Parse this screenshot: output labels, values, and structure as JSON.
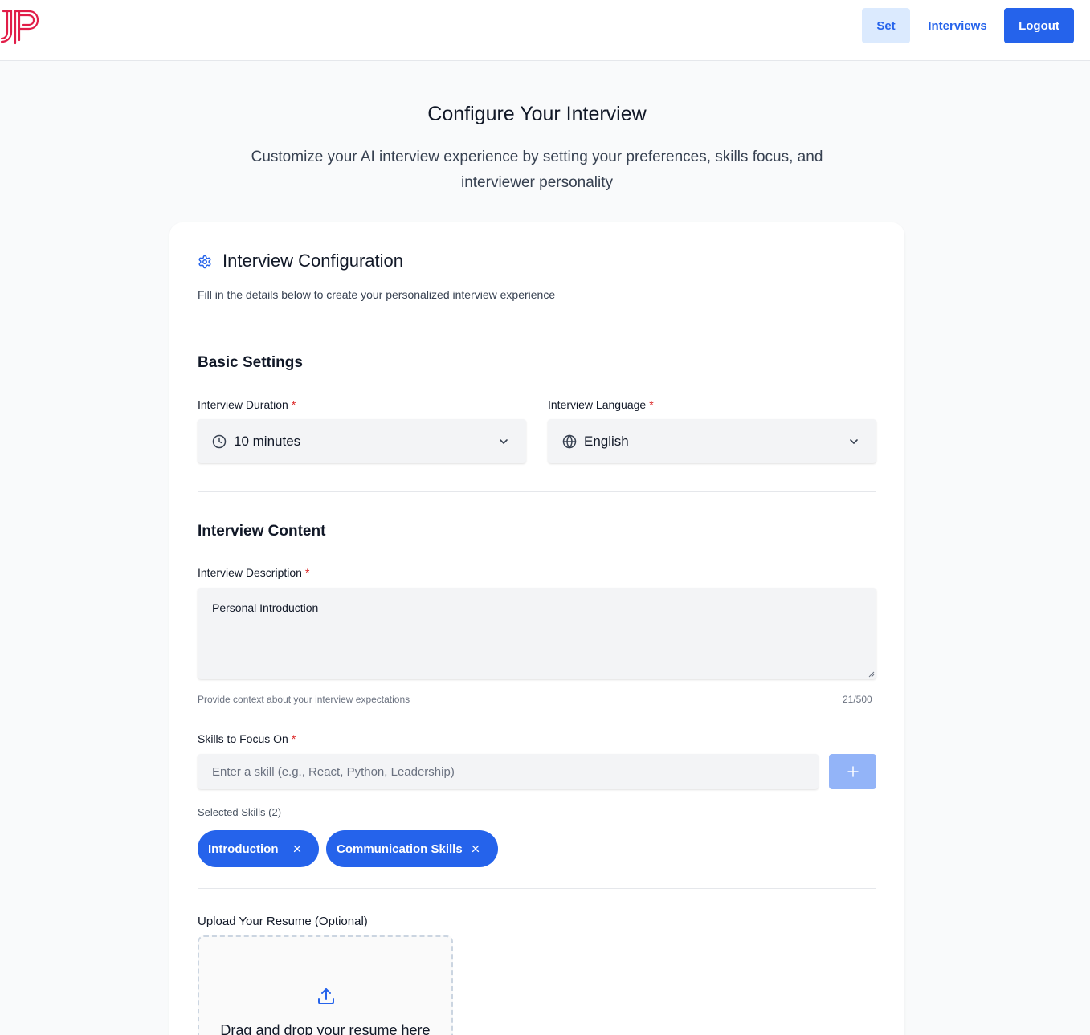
{
  "header": {
    "nav": {
      "set_label": "Set",
      "interviews_label": "Interviews",
      "logout_label": "Logout"
    }
  },
  "page": {
    "title": "Configure Your Interview",
    "subtitle": "Customize your AI interview experience by setting your preferences, skills focus, and interviewer personality"
  },
  "card": {
    "title": "Interview Configuration",
    "description": "Fill in the details below to create your personalized interview experience",
    "basic": {
      "heading": "Basic Settings",
      "duration_label": "Interview Duration",
      "duration_value": "10 minutes",
      "language_label": "Interview Language",
      "language_value": "English",
      "required_mark": "*"
    },
    "content": {
      "heading": "Interview Content",
      "description_label": "Interview Description",
      "description_value": "Personal Introduction",
      "description_helper": "Provide context about your interview expectations",
      "description_count": "21/500",
      "skills_label": "Skills to Focus On",
      "skills_placeholder": "Enter a skill (e.g., React, Python, Leadership)",
      "selected_label": "Selected Skills (2)",
      "skills": [
        "Introduction",
        "Communication Skills"
      ]
    },
    "upload": {
      "label": "Upload Your Resume (Optional)",
      "drop_text": "Drag and drop your resume here"
    }
  },
  "colors": {
    "primary": "#2563eb",
    "primary_light": "#dbeafe",
    "required": "#dc2626",
    "logo": "#e11d48"
  }
}
